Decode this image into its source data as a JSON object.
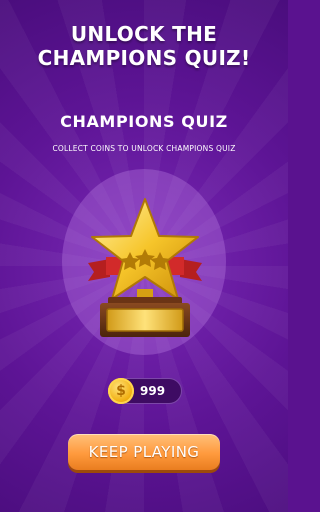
{
  "header": {
    "line1": "UNLOCK THE",
    "line2": "CHAMPIONS QUIZ!"
  },
  "quiz": {
    "title": "CHAMPIONS QUIZ",
    "subtitle": "COLLECT COINS TO UNLOCK CHAMPIONS QUIZ",
    "trophy_icon": "star-trophy-icon"
  },
  "coins": {
    "symbol": "$",
    "count": "999"
  },
  "actions": {
    "keep_playing_label": "KEEP PLAYING"
  },
  "colors": {
    "background": "#5a128f",
    "button": "#ff9a3d",
    "coin": "#f2b115",
    "trophy_gold": "#f6c52a",
    "ribbon": "#d22a2a"
  }
}
